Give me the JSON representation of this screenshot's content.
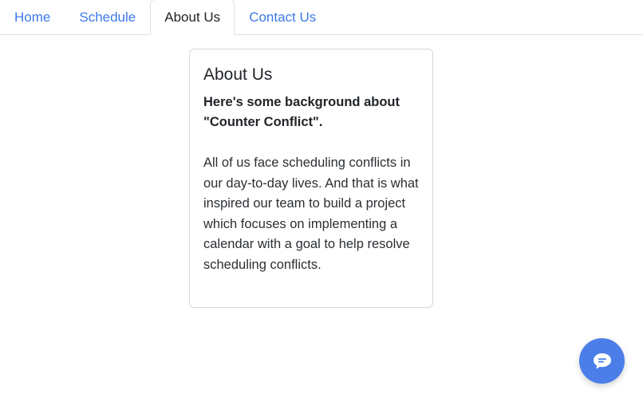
{
  "nav": {
    "tabs": [
      {
        "label": "Home",
        "active": false
      },
      {
        "label": "Schedule",
        "active": false
      },
      {
        "label": "About Us",
        "active": true
      },
      {
        "label": "Contact Us",
        "active": false
      }
    ]
  },
  "card": {
    "title": "About Us",
    "subtitle": "Here's some background about \"Counter Conflict\".",
    "body": "All of us face scheduling conflicts in our day-to-day lives. And that is what inspired our team to build a project which focuses on implementing a calendar with a goal to help resolve scheduling conflicts."
  },
  "chat": {
    "icon": "chat-bubble-icon",
    "color": "#4b7ee8"
  },
  "colors": {
    "link": "#3b78e7",
    "text": "#212529",
    "border": "#dee2e6"
  }
}
